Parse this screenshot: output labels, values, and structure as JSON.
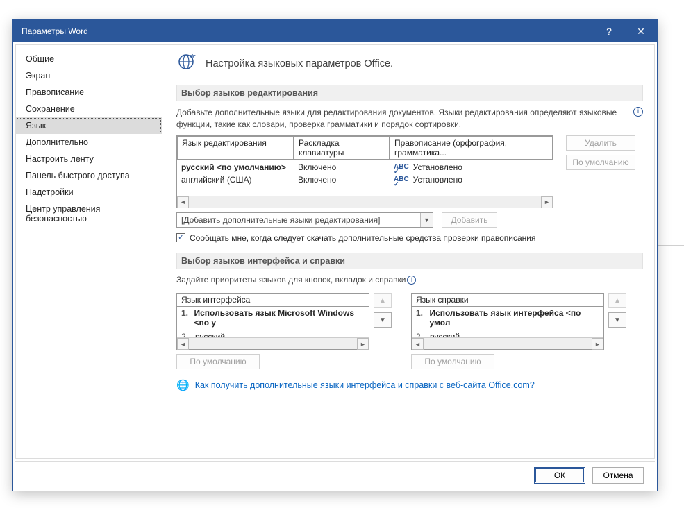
{
  "window": {
    "title": "Параметры Word",
    "help": "?",
    "close": "✕"
  },
  "sidebar": {
    "items": [
      "Общие",
      "Экран",
      "Правописание",
      "Сохранение",
      "Язык",
      "Дополнительно",
      "Настроить ленту",
      "Панель быстрого доступа",
      "Надстройки",
      "Центр управления безопасностью"
    ],
    "selected_index": 4
  },
  "header": {
    "title": "Настройка языковых параметров Office."
  },
  "section_editing": {
    "title": "Выбор языков редактирования",
    "description": "Добавьте дополнительные языки для редактирования документов. Языки редактирования определяют языковые функции, такие как словари, проверка грамматики и порядок сортировки.",
    "table": {
      "col_lang": "Язык редактирования",
      "col_kbd": "Раскладка клавиатуры",
      "col_proof": "Правописание (орфография, грамматика...",
      "rows": [
        {
          "lang": "русский <по умолчанию>",
          "kbd": "Включено",
          "proof": "Установлено",
          "bold": true
        },
        {
          "lang": "английский (США)",
          "kbd": "Включено",
          "proof": "Установлено",
          "bold": false
        }
      ]
    },
    "btn_delete": "Удалить",
    "btn_default": "По умолчанию",
    "dropdown": "[Добавить дополнительные языки редактирования]",
    "btn_add": "Добавить",
    "checkbox": "Сообщать мне, когда следует скачать дополнительные средства проверки правописания"
  },
  "section_ui": {
    "title": "Выбор языков интерфейса и справки",
    "description": "Задайте приоритеты языков для кнопок, вкладок и справки",
    "left": {
      "header": "Язык интерфейса",
      "items": [
        {
          "num": "1.",
          "text": "Использовать язык Microsoft Windows <по у",
          "bold": true
        },
        {
          "num": "2.",
          "text": "русский",
          "bold": false
        }
      ],
      "btn_default": "По умолчанию"
    },
    "right": {
      "header": "Язык справки",
      "items": [
        {
          "num": "1.",
          "text": "Использовать язык интерфейса <по умол",
          "bold": true
        },
        {
          "num": "2.",
          "text": "русский",
          "bold": false
        }
      ],
      "btn_default": "По умолчанию"
    },
    "link": "Как получить дополнительные языки интерфейса и справки с веб-сайта Office.com?"
  },
  "footer": {
    "ok": "ОК",
    "cancel": "Отмена"
  }
}
